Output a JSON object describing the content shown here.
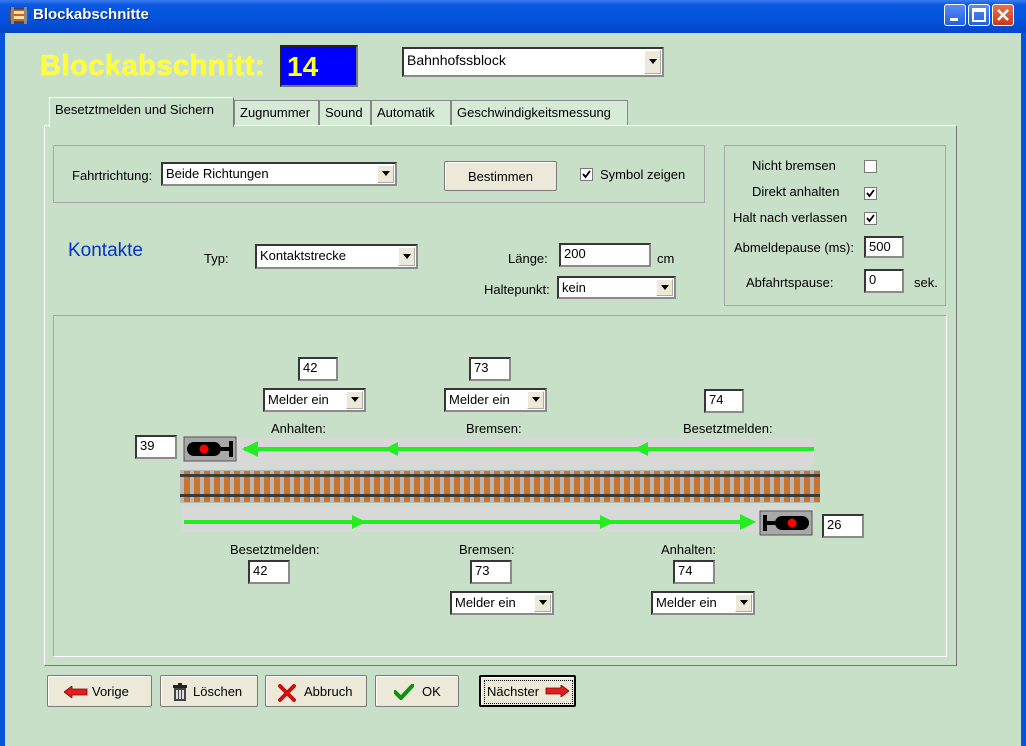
{
  "window": {
    "title": "Blockabschnitte"
  },
  "header": {
    "block_label": "Blockabschnitt:",
    "block_number": "14",
    "block_type": "Bahnhofssblock"
  },
  "tabs": [
    "Besetztmelden und Sichern",
    "Zugnummer",
    "Sound",
    "Automatik",
    "Geschwindigkeitsmessung"
  ],
  "direction": {
    "label": "Fahrtrichtung:",
    "value": "Beide Richtungen",
    "determine_button": "Bestimmen",
    "symbol_label": "Symbol zeigen",
    "symbol_checked": true
  },
  "options": {
    "no_brake_label": "Nicht bremsen",
    "no_brake": false,
    "direct_stop_label": "Direkt anhalten",
    "direct_stop": true,
    "stop_after_leave_label": "Halt nach verlassen",
    "stop_after_leave": true,
    "signoff_pause_label": "Abmeldepause (ms):",
    "signoff_pause": "500",
    "departure_pause_label": "Abfahrtspause:",
    "departure_pause": "0",
    "departure_unit": "sek."
  },
  "contacts": {
    "heading": "Kontakte",
    "type_label": "Typ:",
    "type_value": "Kontaktstrecke",
    "length_label": "Länge:",
    "length_value": "200",
    "length_unit": "cm",
    "stop_point_label": "Haltepunkt:",
    "stop_point_value": "kein"
  },
  "track": {
    "top": {
      "signal_contact": "39",
      "anhalten": {
        "label": "Anhalten:",
        "contact": "42",
        "mode": "Melder ein"
      },
      "bremsen": {
        "label": "Bremsen:",
        "contact": "73",
        "mode": "Melder ein"
      },
      "besetztmelden": {
        "label": "Besetztmelden:",
        "contact": "74"
      }
    },
    "bottom": {
      "signal_contact": "26",
      "besetztmelden": {
        "label": "Besetztmelden:",
        "contact": "42"
      },
      "bremsen": {
        "label": "Bremsen:",
        "contact": "73",
        "mode": "Melder ein"
      },
      "anhalten": {
        "label": "Anhalten:",
        "contact": "74",
        "mode": "Melder ein"
      }
    }
  },
  "buttons": {
    "previous": "Vorige",
    "delete": "Löschen",
    "cancel": "Abbruch",
    "ok": "OK",
    "next": "Nächster"
  },
  "colors": {
    "title_yellow": "#ffff33",
    "number_bg": "#0000ff",
    "arrow_green": "#22ee22",
    "kontakte_blue": "#0033cc",
    "background": "#c8e0c8"
  }
}
